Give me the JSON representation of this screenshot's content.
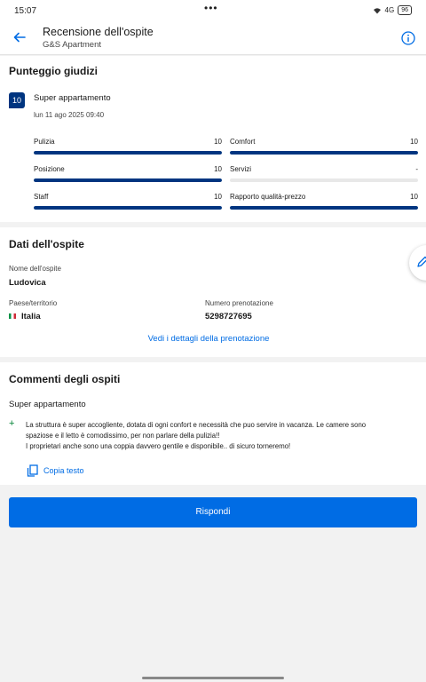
{
  "status_bar": {
    "time": "15:07",
    "dots": "•••",
    "signal": "4G",
    "battery": "96"
  },
  "header": {
    "title": "Recensione dell'ospite",
    "subtitle": "G&S Apartment"
  },
  "scores": {
    "title": "Punteggio giudizi",
    "overall": "10",
    "overall_word": "Super appartamento",
    "date": "lun 11 ago 2025 09:40",
    "categories": [
      {
        "label": "Pulizia",
        "value": "10",
        "fill": 1.0
      },
      {
        "label": "Comfort",
        "value": "10",
        "fill": 1.0
      },
      {
        "label": "Posizione",
        "value": "10",
        "fill": 1.0
      },
      {
        "label": "Servizi",
        "value": "-",
        "fill": 0.0
      },
      {
        "label": "Staff",
        "value": "10",
        "fill": 1.0
      },
      {
        "label": "Rapporto qualità-prezzo",
        "value": "10",
        "fill": 1.0
      }
    ]
  },
  "guest": {
    "title": "Dati dell'ospite",
    "name_label": "Nome dell'ospite",
    "name": "Ludovica",
    "country_label": "Paese/territorio",
    "country": "Italia",
    "booking_label": "Numero prenotazione",
    "booking_number": "5298727695",
    "details_link": "Vedi i dettagli della prenotazione"
  },
  "comments": {
    "title": "Commenti degli ospiti",
    "headline": "Super appartamento",
    "positive_line1": "La struttura è super accogliente, dotata di ogni confort e necessità che puo servire in vacanza. Le camere sono",
    "positive_line2": "spaziose e il letto è comodissimo, per non parlare della pulizia!!",
    "positive_line3": "I proprietari anche sono una coppia davvero gentile e disponibile.. di sicuro torneremo!",
    "copy_label": "Copia testo"
  },
  "actions": {
    "reply_label": "Rispondi"
  },
  "colors": {
    "brand_dark": "#003580",
    "link_blue": "#006ce4",
    "positive_green": "#008234"
  }
}
